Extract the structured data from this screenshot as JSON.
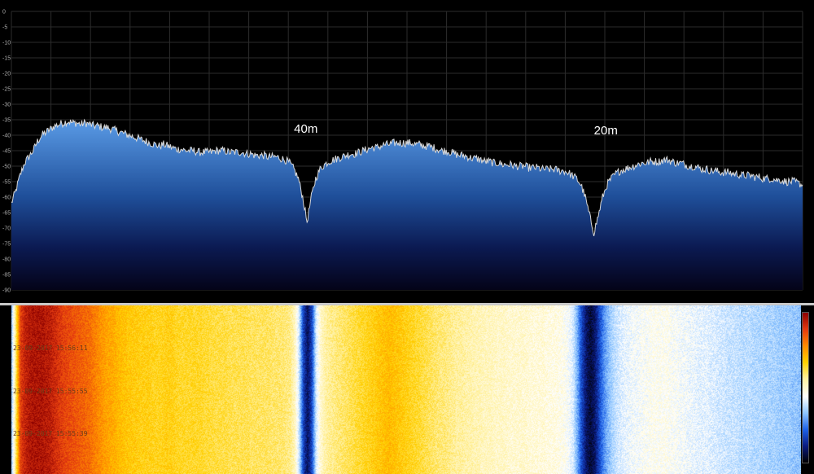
{
  "chart_data": {
    "type": "area",
    "title": "",
    "xlabel": "",
    "ylabel": "",
    "ylim": [
      -90,
      0
    ],
    "yticks": [
      "0",
      "-5",
      "-10",
      "-15",
      "-20",
      "-25",
      "-30",
      "-35",
      "-40",
      "-45",
      "-50",
      "-55",
      "-60",
      "-65",
      "-70",
      "-75",
      "-80",
      "-85",
      "-90"
    ],
    "grid": true,
    "annotations": [
      {
        "text": "40m",
        "near_point": 68
      },
      {
        "text": "20m",
        "near_point": 137
      }
    ],
    "series": [
      {
        "values": [
          -62,
          -58,
          -53,
          -49,
          -47,
          -45,
          -42,
          -40,
          -39,
          -38,
          -37,
          -36.5,
          -36,
          -35.5,
          -36,
          -36,
          -36.5,
          -36,
          -36.5,
          -37,
          -37,
          -37.5,
          -37.5,
          -38,
          -38.5,
          -39,
          -39.5,
          -40,
          -40.5,
          -41,
          -41.5,
          -42,
          -42.5,
          -43,
          -43.5,
          -43,
          -43.5,
          -44,
          -44.5,
          -44.5,
          -45,
          -45,
          -45,
          -45.5,
          -45.5,
          -45.5,
          -45.5,
          -45,
          -45,
          -45,
          -45.5,
          -45.5,
          -45.5,
          -45.5,
          -46,
          -46,
          -46.5,
          -46.5,
          -46.5,
          -47,
          -47,
          -47,
          -47.5,
          -48,
          -49,
          -51,
          -54,
          -60,
          -68,
          -60,
          -54,
          -51,
          -49.5,
          -48.5,
          -48,
          -47.5,
          -47,
          -46.5,
          -46,
          -46,
          -45.5,
          -45,
          -44.5,
          -44,
          -44,
          -43.5,
          -43,
          -43,
          -42.5,
          -42.5,
          -42.5,
          -42.5,
          -42.5,
          -43,
          -43,
          -43.5,
          -43.5,
          -44,
          -44.5,
          -45,
          -45,
          -45.5,
          -46,
          -46.5,
          -46.5,
          -47,
          -47.5,
          -47.5,
          -48,
          -48.5,
          -48.5,
          -49,
          -49,
          -49.5,
          -49.5,
          -49.5,
          -50,
          -50,
          -50,
          -50.5,
          -50.5,
          -50.5,
          -51,
          -51,
          -51,
          -51,
          -51.5,
          -51.5,
          -52,
          -53,
          -54,
          -56,
          -60,
          -66,
          -71.5,
          -66,
          -60,
          -56,
          -54,
          -52.5,
          -51.5,
          -51,
          -50.5,
          -50,
          -49.5,
          -49,
          -49,
          -48.5,
          -48.5,
          -48.5,
          -48,
          -48,
          -48.5,
          -49,
          -49,
          -49.5,
          -50,
          -50,
          -50.5,
          -51,
          -51,
          -51.5,
          -51.5,
          -52,
          -52,
          -52,
          -52.5,
          -52.5,
          -53,
          -53,
          -53,
          -53.5,
          -53.5,
          -54,
          -54,
          -54,
          -54.5,
          -54.5,
          -55,
          -55,
          -55,
          -55.5,
          -56
        ]
      }
    ],
    "colors": {
      "grid": "#2c2c2c",
      "trace": "#d8d8d8",
      "fill_top": "#5a9be6",
      "fill_bottom": "#040318",
      "waterfall_palette": [
        "#000000",
        "#0a1a80",
        "#1e62e8",
        "#8fc6ff",
        "#ffffff",
        "#fff1a0",
        "#ffd000",
        "#ff8a00",
        "#e43a10",
        "#8b0000"
      ]
    }
  },
  "waterfall": {
    "timestamps": [
      "23-09-2017 15:56:11",
      "23-09-2017 15:55:55",
      "23-09-2017 15:55:39"
    ],
    "column_levels": [
      0.35,
      0.6,
      0.88,
      0.93,
      0.95,
      0.96,
      0.96,
      0.96,
      0.95,
      0.94,
      0.92,
      0.9,
      0.88,
      0.87,
      0.86,
      0.85,
      0.84,
      0.83,
      0.82,
      0.8,
      0.78,
      0.76,
      0.74,
      0.73,
      0.72,
      0.7,
      0.69,
      0.68,
      0.67,
      0.67,
      0.66,
      0.66,
      0.66,
      0.65,
      0.65,
      0.65,
      0.66,
      0.66,
      0.65,
      0.64,
      0.64,
      0.64,
      0.64,
      0.64,
      0.64,
      0.63,
      0.63,
      0.62,
      0.62,
      0.62,
      0.62,
      0.61,
      0.61,
      0.61,
      0.61,
      0.61,
      0.6,
      0.6,
      0.6,
      0.6,
      0.6,
      0.59,
      0.59,
      0.59,
      0.58,
      0.57,
      0.52,
      0.4,
      0.18,
      0.08,
      0.18,
      0.4,
      0.5,
      0.54,
      0.56,
      0.57,
      0.58,
      0.59,
      0.6,
      0.61,
      0.62,
      0.63,
      0.64,
      0.65,
      0.66,
      0.67,
      0.68,
      0.69,
      0.7,
      0.69,
      0.68,
      0.67,
      0.66,
      0.65,
      0.64,
      0.63,
      0.62,
      0.61,
      0.6,
      0.59,
      0.58,
      0.58,
      0.57,
      0.56,
      0.55,
      0.55,
      0.54,
      0.54,
      0.53,
      0.53,
      0.52,
      0.52,
      0.52,
      0.51,
      0.51,
      0.51,
      0.5,
      0.5,
      0.5,
      0.5,
      0.5,
      0.49,
      0.49,
      0.49,
      0.49,
      0.48,
      0.48,
      0.48,
      0.47,
      0.46,
      0.44,
      0.4,
      0.3,
      0.18,
      0.09,
      0.05,
      0.09,
      0.18,
      0.26,
      0.32,
      0.36,
      0.39,
      0.41,
      0.42,
      0.43,
      0.44,
      0.44,
      0.45,
      0.45,
      0.46,
      0.46,
      0.46,
      0.46,
      0.46,
      0.45,
      0.45,
      0.44,
      0.44,
      0.43,
      0.43,
      0.42,
      0.42,
      0.42,
      0.41,
      0.41,
      0.4,
      0.4,
      0.39,
      0.39,
      0.39,
      0.38,
      0.38,
      0.38,
      0.37,
      0.37,
      0.37,
      0.36,
      0.36,
      0.36,
      0.35,
      0.35,
      0.35,
      0.34,
      0.34,
      0.33
    ]
  }
}
